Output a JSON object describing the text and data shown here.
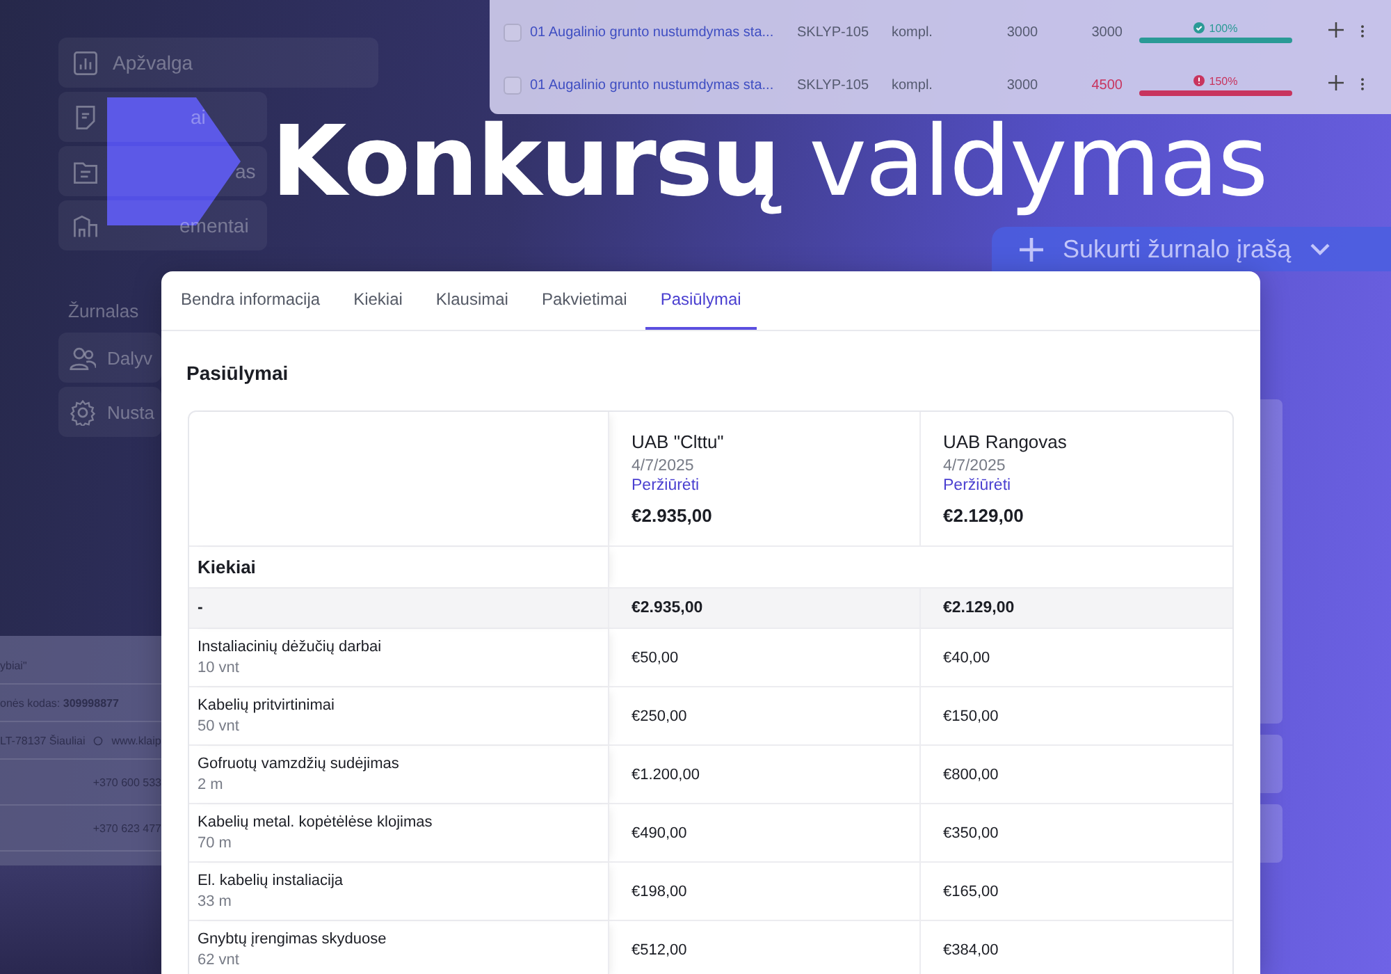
{
  "items_panel": {
    "rows": [
      {
        "checked": false,
        "name": "01 Augalinio grunto nustumdymas sta...",
        "code": "SKLYP-105",
        "unit": "kompl.",
        "planned": "3000",
        "actual": "3000",
        "over": false,
        "percent": "100%",
        "level": 1,
        "color": "#2a9a96"
      },
      {
        "checked": false,
        "name": "01 Augalinio grunto nustumdymas sta...",
        "code": "SKLYP-105",
        "unit": "kompl.",
        "planned": "3000",
        "actual": "4500",
        "over": true,
        "percent": "150%",
        "level": 1,
        "color": "#c8345e"
      }
    ]
  },
  "sidebar": {
    "items": [
      {
        "kind": "chart",
        "label": "Apžvalga"
      },
      {
        "kind": "document",
        "label": "ai"
      },
      {
        "kind": "folder",
        "label": "as"
      },
      {
        "kind": "building",
        "label": "ementai"
      }
    ],
    "section": "Žurnalas",
    "section_items": [
      {
        "kind": "users",
        "label": "Dalyv"
      },
      {
        "kind": "gear",
        "label": "Nusta"
      }
    ]
  },
  "headline": {
    "text": "**Konkursų** valdymas"
  },
  "create_button": {
    "label": "Sukurti žurnalo įrašą"
  },
  "company_card": {
    "name": "ybiai\"",
    "code_label": "onės kodas:",
    "code": "309998877",
    "address": "LT-78137 Šiauliai",
    "website": "www.klaip",
    "phones": [
      "+370 600 533",
      "+370 623 477"
    ]
  },
  "offers_card": {
    "tabs": [
      {
        "label": "Bendra informacija",
        "selected": false
      },
      {
        "label": "Kiekiai",
        "selected": false
      },
      {
        "label": "Klausimai",
        "selected": false
      },
      {
        "label": "Pakvietimai",
        "selected": false
      },
      {
        "label": "Pasiūlymai",
        "selected": true
      }
    ],
    "title": "Pasiūlymai",
    "bidders": [
      {
        "name": "UAB \"Clttu\"",
        "date": "4/7/2025",
        "link": "Peržiūrėti",
        "total": "€2.935,00"
      },
      {
        "name": "UAB Rangovas",
        "date": "4/7/2025",
        "link": "Peržiūrėti",
        "total": "€2.129,00"
      }
    ],
    "section": "Kiekiai",
    "summary_row": {
      "label": "-",
      "values": [
        "€2.935,00",
        "€2.129,00"
      ]
    },
    "rows": [
      {
        "name": "Instaliacinių dėžučių darbai",
        "quantity": "10 vnt",
        "values": [
          "€50,00",
          "€40,00"
        ]
      },
      {
        "name": "Kabelių pritvirtinimai",
        "quantity": "50 vnt",
        "values": [
          "€250,00",
          "€150,00"
        ]
      },
      {
        "name": "Gofruotų vamzdžių sudėjimas",
        "quantity": "2 m",
        "values": [
          "€1.200,00",
          "€800,00"
        ]
      },
      {
        "name": "Kabelių metal. kopėtėlėse klojimas",
        "quantity": "70 m",
        "values": [
          "€490,00",
          "€350,00"
        ]
      },
      {
        "name": "El. kabelių instaliacija",
        "quantity": "33 m",
        "values": [
          "€198,00",
          "€165,00"
        ]
      },
      {
        "name": "Gnybtų įrengimas skyduose",
        "quantity": "62 vnt",
        "values": [
          "€512,00",
          "€384,00"
        ]
      }
    ]
  }
}
